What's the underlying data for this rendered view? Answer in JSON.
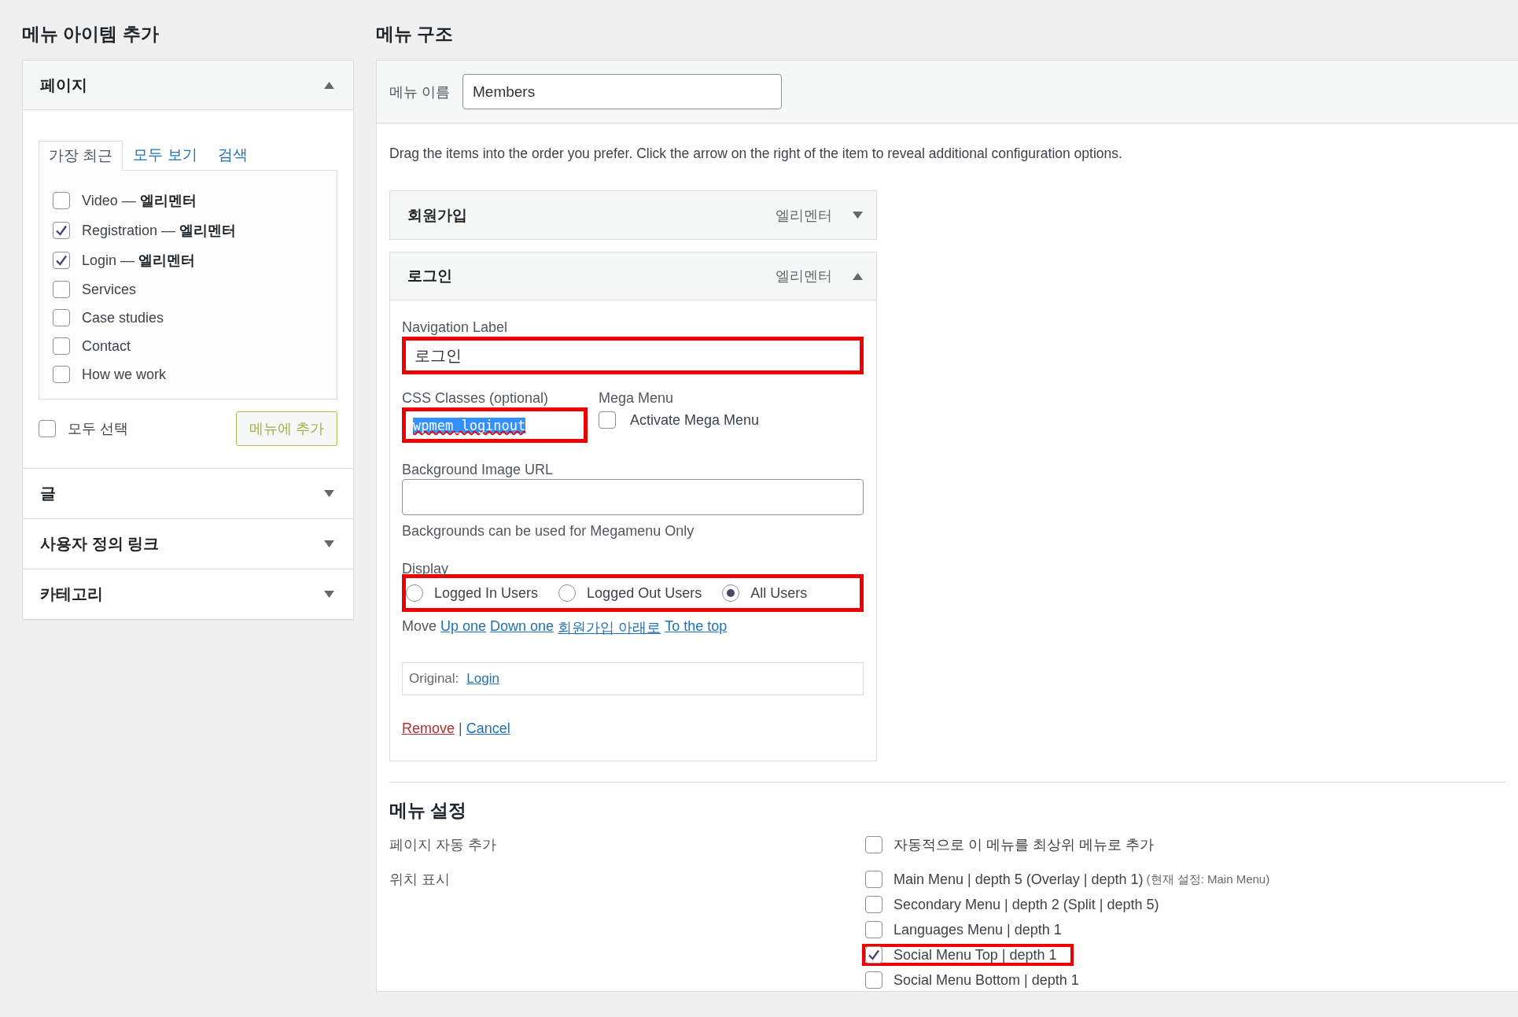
{
  "add_items": {
    "title": "메뉴 아이템 추가",
    "sections": [
      {
        "title": "페이지",
        "expanded": true,
        "tabs": [
          {
            "label": "가장 최근",
            "selected": true
          },
          {
            "label": "모두 보기",
            "selected": false
          },
          {
            "label": "검색",
            "selected": false
          }
        ],
        "items": [
          {
            "label": "Video — **엘리멘터**",
            "checked": false
          },
          {
            "label": "Registration — **엘리멘터**",
            "checked": true
          },
          {
            "label": "Login — **엘리멘터**",
            "checked": true
          },
          {
            "label": "Services",
            "checked": false
          },
          {
            "label": "Case studies",
            "checked": false
          },
          {
            "label": "Contact",
            "checked": false
          },
          {
            "label": "How we work",
            "checked": false
          }
        ],
        "select_all": {
          "label": "모두 선택",
          "checked": false
        },
        "add_button": "메뉴에 추가"
      },
      {
        "title": "글",
        "expanded": false
      },
      {
        "title": "사용자 정의 링크",
        "expanded": false
      },
      {
        "title": "카테고리",
        "expanded": false
      }
    ]
  },
  "structure": {
    "title": "메뉴 구조",
    "name_label": "메뉴 이름",
    "name_value": "Members",
    "instructions": "Drag the items into the order you prefer. Click the arrow on the right of the item to reveal additional configuration options.",
    "items": [
      {
        "title": "회원가입",
        "type_label": "엘리멘터",
        "expanded": false
      },
      {
        "title": "로그인",
        "type_label": "엘리멘터",
        "expanded": true,
        "settings": {
          "navigation_label": {
            "label": "Navigation Label",
            "value": "로그인",
            "highlighted": true
          },
          "css_classes": {
            "label": "CSS Classes (optional)",
            "value": "wpmem_loginout",
            "text_selected": true,
            "highlighted": true
          },
          "mega_menu": {
            "label": "Mega Menu",
            "option": "Activate Mega Menu",
            "checked": false
          },
          "background_image": {
            "label": "Background Image URL",
            "hint": "Backgrounds can be used for Megamenu Only"
          },
          "display": {
            "label": "Display",
            "highlighted": true,
            "options": [
              {
                "label": "Logged In Users",
                "selected": false
              },
              {
                "label": "Logged Out Users",
                "selected": false
              },
              {
                "label": "All Users",
                "selected": true
              }
            ]
          },
          "move": {
            "label": "Move",
            "links": [
              "Up one",
              "Down one",
              "회원가입 아래로",
              "To the top"
            ]
          },
          "original": {
            "label": "Original:",
            "link": "Login"
          },
          "remove": "Remove",
          "separator": "|",
          "cancel": "Cancel"
        }
      }
    ]
  },
  "settings": {
    "title": "메뉴 설정",
    "auto_add": {
      "label": "페이지 자동 추가",
      "option": {
        "label": "자동적으로 이 메뉴를 최상위 메뉴로 추가",
        "checked": false
      }
    },
    "locations": {
      "label": "위치 표시",
      "options": [
        {
          "label": "Main Menu | depth 5 (Overlay | depth 1)",
          "note": "(현재 설정: Main Menu)",
          "checked": false,
          "highlighted": false
        },
        {
          "label": "Secondary Menu | depth 2 (Split | depth 5)",
          "checked": false,
          "highlighted": false
        },
        {
          "label": "Languages Menu | depth 1",
          "checked": false,
          "highlighted": false
        },
        {
          "label": "Social Menu Top | depth 1",
          "checked": true,
          "highlighted": true
        },
        {
          "label": "Social Menu Bottom | depth 1",
          "checked": false,
          "highlighted": false
        }
      ]
    }
  }
}
